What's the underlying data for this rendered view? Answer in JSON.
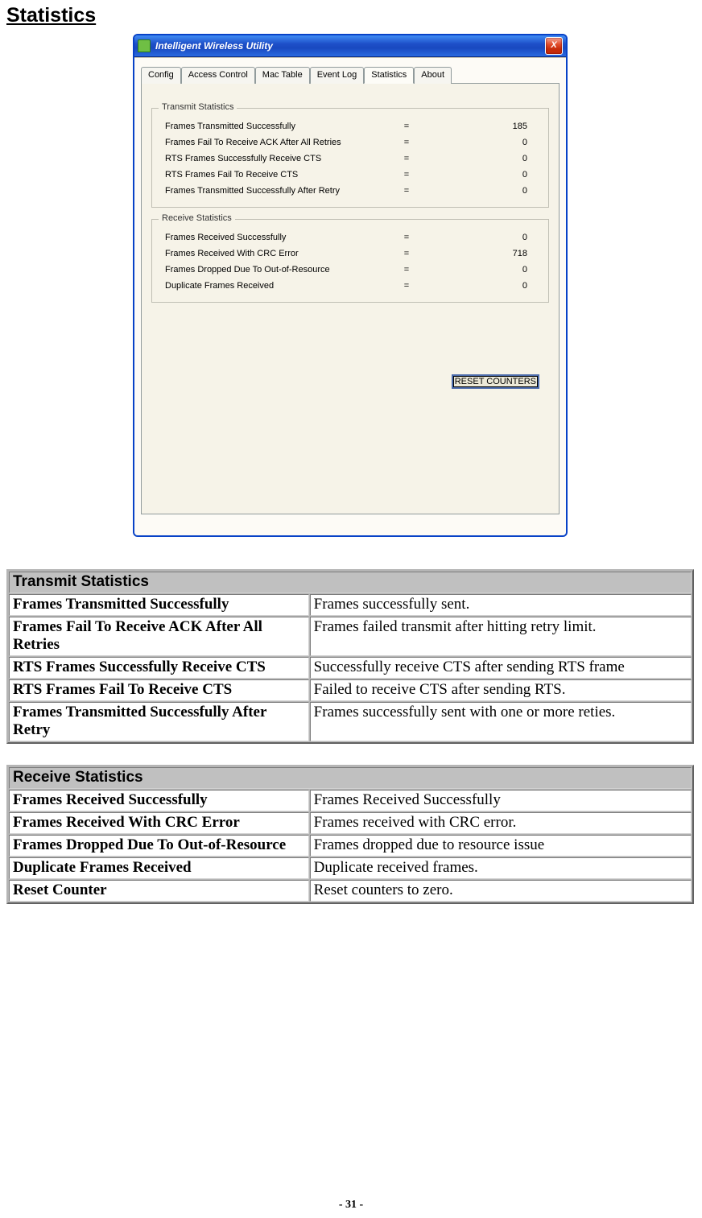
{
  "page": {
    "heading": "Statistics",
    "footer": "- 31 -"
  },
  "window": {
    "title": "Intelligent Wireless Utility",
    "close_glyph": "X",
    "tabs": [
      "Config",
      "Access Control",
      "Mac Table",
      "Event Log",
      "Statistics",
      "About"
    ],
    "active_tab_index": 4,
    "reset_button": "RESET COUNTERS",
    "transmit": {
      "legend": "Transmit Statistics",
      "rows": [
        {
          "label": "Frames Transmitted Successfully",
          "eq": "=",
          "value": "185"
        },
        {
          "label": "Frames Fail To Receive ACK After All Retries",
          "eq": "=",
          "value": "0"
        },
        {
          "label": "RTS Frames Successfully Receive CTS",
          "eq": "=",
          "value": "0"
        },
        {
          "label": "RTS Frames Fail To Receive CTS",
          "eq": "=",
          "value": "0"
        },
        {
          "label": "Frames Transmitted Successfully After Retry",
          "eq": "=",
          "value": "0"
        }
      ]
    },
    "receive": {
      "legend": "Receive Statistics",
      "rows": [
        {
          "label": "Frames Received Successfully",
          "eq": "=",
          "value": "0"
        },
        {
          "label": "Frames Received With CRC Error",
          "eq": "=",
          "value": "718"
        },
        {
          "label": "Frames Dropped Due To Out-of-Resource",
          "eq": "=",
          "value": "0"
        },
        {
          "label": "Duplicate Frames Received",
          "eq": "=",
          "value": "0"
        }
      ]
    }
  },
  "tables": {
    "transmit": {
      "header": "Transmit Statistics",
      "rows": [
        {
          "term": "Frames Transmitted Successfully",
          "desc": "Frames successfully sent."
        },
        {
          "term": "Frames Fail To Receive ACK After All Retries",
          "desc": "Frames failed transmit after hitting retry limit."
        },
        {
          "term": "RTS Frames Successfully Receive CTS",
          "desc": "Successfully receive CTS after sending RTS frame"
        },
        {
          "term": "RTS Frames Fail To Receive CTS",
          "desc": "Failed to receive CTS after sending RTS."
        },
        {
          "term": "Frames Transmitted Successfully After Retry",
          "desc": "Frames successfully sent with one or more reties."
        }
      ]
    },
    "receive": {
      "header": "Receive Statistics",
      "rows": [
        {
          "term": "Frames Received Successfully",
          "desc": "Frames Received Successfully"
        },
        {
          "term": "Frames Received With CRC Error",
          "desc": "Frames received with CRC error."
        },
        {
          "term": "Frames Dropped Due To Out-of-Resource",
          "desc": "Frames dropped due to resource issue"
        },
        {
          "term": "Duplicate Frames Received",
          "desc": "Duplicate received frames."
        },
        {
          "term": "Reset Counter",
          "desc": "Reset counters to zero."
        }
      ]
    }
  }
}
